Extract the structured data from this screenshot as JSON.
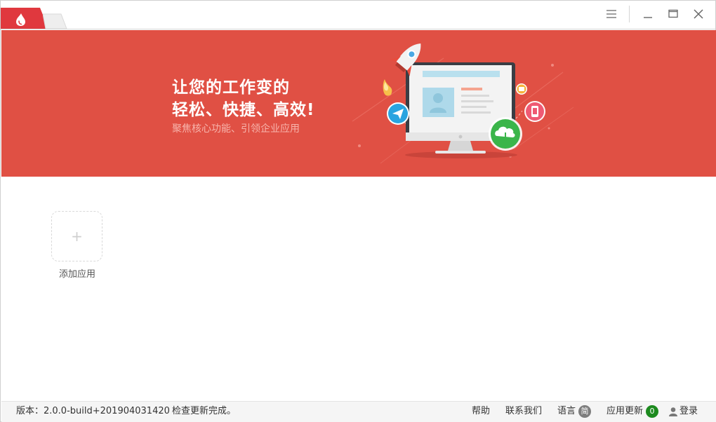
{
  "titlebar": {
    "active_tab_icon": "drop-logo-icon",
    "menu_icon": "hamburger-menu-icon",
    "minimize_icon": "minimize-icon",
    "maximize_icon": "maximize-icon",
    "close_icon": "close-icon"
  },
  "banner": {
    "headline_line1": "让您的工作变的",
    "headline_line2": "轻松、快捷、高效!",
    "subtitle": "聚焦核心功能、引领企业应用",
    "background_color": "#e05044"
  },
  "apps": {
    "add_label": "添加应用",
    "add_symbol": "+"
  },
  "footer": {
    "version": "版本：2.0.0-build+201904031420",
    "status": "检查更新完成。",
    "help": "帮助",
    "contact": "联系我们",
    "language_label": "语言",
    "language_badge": "简",
    "update_label": "应用更新",
    "update_count": "0",
    "login": "登录"
  }
}
